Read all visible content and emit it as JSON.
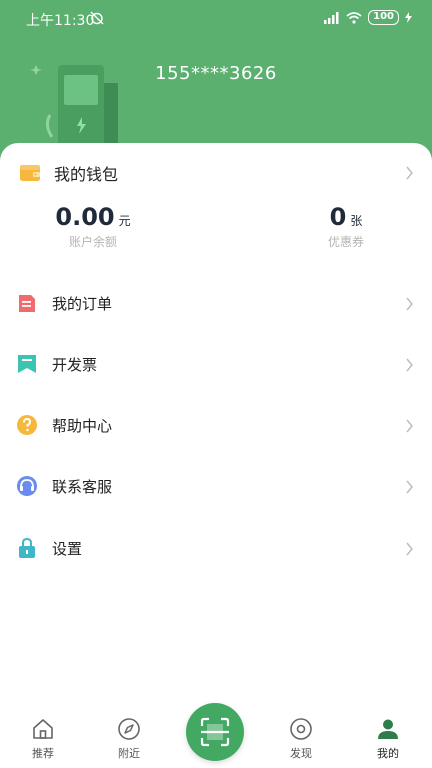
{
  "status_bar": {
    "time": "上午11:30",
    "battery": "100"
  },
  "profile": {
    "phone": "155****3626"
  },
  "wallet": {
    "title": "我的钱包",
    "balance": {
      "value": "0.00",
      "unit": "元",
      "label": "账户余额"
    },
    "coupons": {
      "value": "0",
      "unit": "张",
      "label": "优惠券"
    }
  },
  "menu": [
    {
      "label": "我的订单",
      "icon": "order-icon",
      "color": "#f06b6b"
    },
    {
      "label": "开发票",
      "icon": "invoice-icon",
      "color": "#3cc4b1"
    },
    {
      "label": "帮助中心",
      "icon": "help-icon",
      "color": "#f5b83d"
    },
    {
      "label": "联系客服",
      "icon": "customer-service-icon",
      "color": "#6b8cef"
    },
    {
      "label": "设置",
      "icon": "settings-lock-icon",
      "color": "#3fb7c9"
    }
  ],
  "tabbar": {
    "tabs": [
      {
        "label": "推荐",
        "icon": "home-icon"
      },
      {
        "label": "附近",
        "icon": "compass-icon"
      },
      {
        "label": "发现",
        "icon": "discover-icon"
      },
      {
        "label": "我的",
        "icon": "profile-icon",
        "active": true
      }
    ],
    "scan_icon": "scan-icon"
  },
  "colors": {
    "header": "#5bb070",
    "scan": "#43a862",
    "text_dark": "#1f2a3a"
  }
}
